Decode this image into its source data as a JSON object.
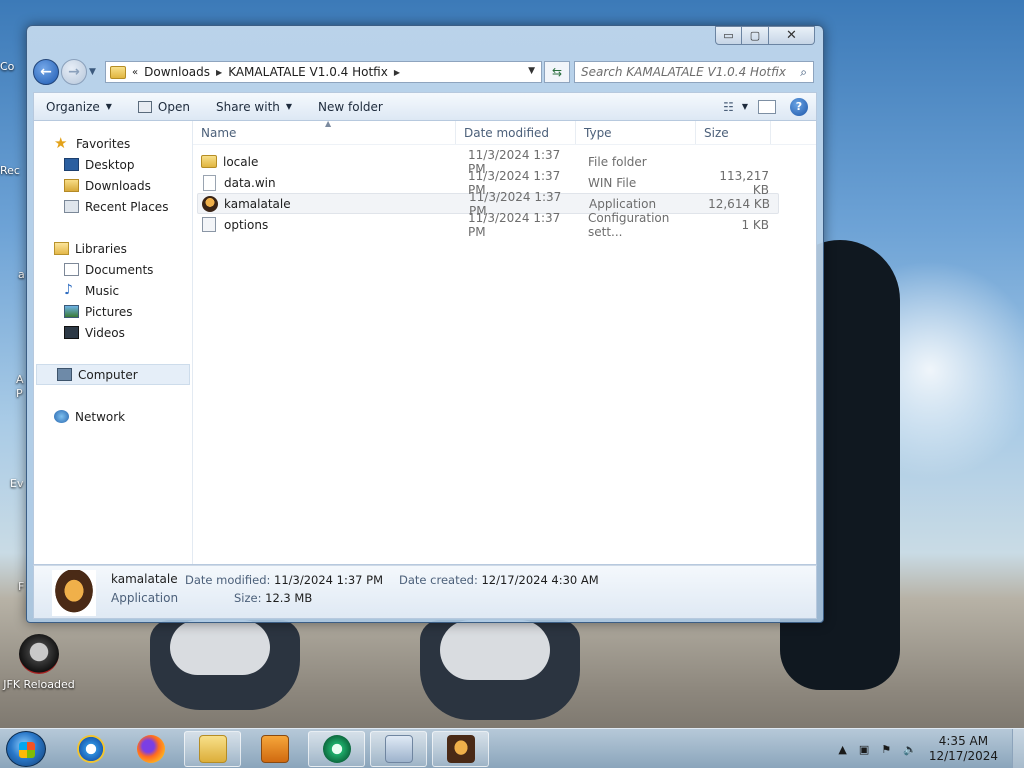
{
  "window": {
    "address_crumbs": [
      "Downloads",
      "KAMALATALE V1.0.4 Hotfix"
    ],
    "search_placeholder": "Search KAMALATALE V1.0.4 Hotfix",
    "caption": {
      "minimize": "▭",
      "maximize": "▢",
      "close": "✕"
    }
  },
  "toolbar": {
    "organize": "Organize",
    "open": "Open",
    "share_with": "Share with",
    "new_folder": "New folder"
  },
  "nav_pane": {
    "favorites": "Favorites",
    "desktop": "Desktop",
    "downloads": "Downloads",
    "recent_places": "Recent Places",
    "libraries": "Libraries",
    "documents": "Documents",
    "music": "Music",
    "pictures": "Pictures",
    "videos": "Videos",
    "computer": "Computer",
    "network": "Network"
  },
  "columns": {
    "name": "Name",
    "date": "Date modified",
    "type": "Type",
    "size": "Size"
  },
  "files": [
    {
      "name": "locale",
      "date": "11/3/2024 1:37 PM",
      "type": "File folder",
      "size": "",
      "icon": "folder-icon"
    },
    {
      "name": "data.win",
      "date": "11/3/2024 1:37 PM",
      "type": "WIN File",
      "size": "113,217 KB",
      "icon": "file-icon"
    },
    {
      "name": "kamalatale",
      "date": "11/3/2024 1:37 PM",
      "type": "Application",
      "size": "12,614 KB",
      "icon": "app-icon"
    },
    {
      "name": "options",
      "date": "11/3/2024 1:37 PM",
      "type": "Configuration sett...",
      "size": "1 KB",
      "icon": "config-icon"
    }
  ],
  "details": {
    "name": "kamalatale",
    "type": "Application",
    "modified_label": "Date modified:",
    "modified_value": "11/3/2024 1:37 PM",
    "size_label": "Size:",
    "size_value": "12.3 MB",
    "created_label": "Date created:",
    "created_value": "12/17/2024 4:30 AM"
  },
  "desktop": {
    "jfk_label": "JFK Reloaded",
    "partial_labels": [
      "Co",
      "Rec",
      "a",
      "A",
      "P",
      "Ev",
      "F"
    ]
  },
  "tray": {
    "time": "4:35 AM",
    "date": "12/17/2024"
  }
}
